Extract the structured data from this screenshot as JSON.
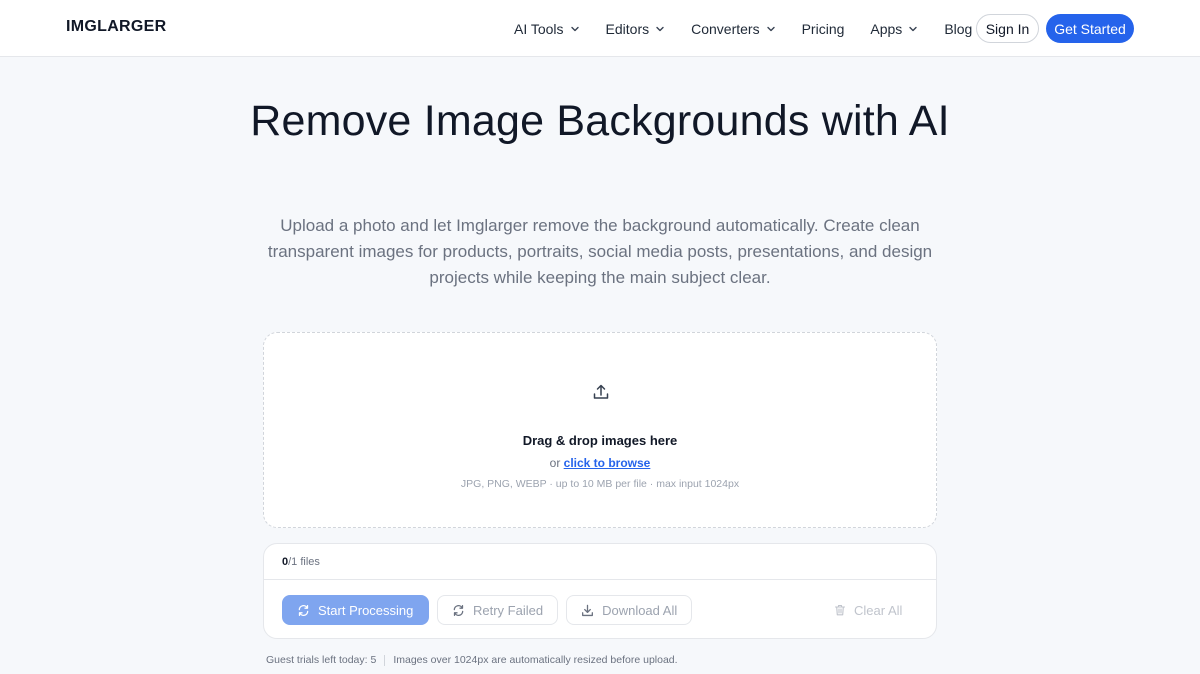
{
  "header": {
    "logo": "IMGLARGER",
    "nav": [
      {
        "label": "AI Tools",
        "has_dropdown": true
      },
      {
        "label": "Editors",
        "has_dropdown": true
      },
      {
        "label": "Converters",
        "has_dropdown": true
      },
      {
        "label": "Pricing",
        "has_dropdown": false
      },
      {
        "label": "Apps",
        "has_dropdown": true
      },
      {
        "label": "Blog",
        "has_dropdown": false
      }
    ],
    "sign_in": "Sign In",
    "get_started": "Get Started"
  },
  "hero": {
    "title": "Remove Image Backgrounds with AI",
    "subtitle": "Upload a photo and let Imglarger remove the background automatically. Create clean transparent images for products, portraits, social media posts, presentations, and design projects while keeping the main subject clear."
  },
  "dropzone": {
    "icon": "upload-icon",
    "title": "Drag & drop images here",
    "or_text": "or",
    "browse_link": "click to browse",
    "hint": "JPG, PNG, WEBP · up to 10 MB per file · max input 1024px"
  },
  "files_panel": {
    "count": "0",
    "total_text": "/1 files",
    "start_processing": "Start Processing",
    "retry_failed": "Retry Failed",
    "download_all": "Download All",
    "clear_all": "Clear All"
  },
  "footer_note": {
    "trials": "Guest trials left today: 5",
    "resize_note": "Images over 1024px are automatically resized before upload."
  },
  "colors": {
    "accent": "#2563eb",
    "accent_disabled": "#7fa5ef",
    "background": "#f6f8fb"
  }
}
